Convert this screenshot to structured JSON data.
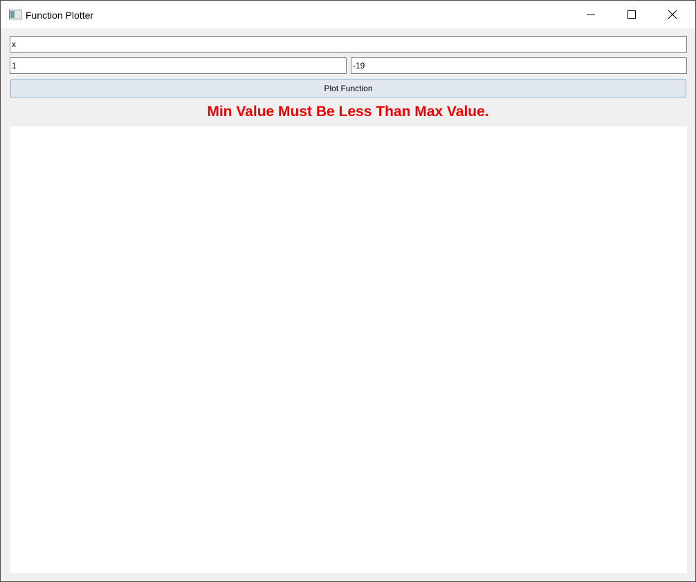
{
  "window": {
    "title": "Function Plotter",
    "icon": "app-window-icon",
    "controls": [
      "minimize-icon",
      "maximize-icon",
      "close-icon"
    ]
  },
  "inputs": {
    "function_value": "x",
    "min_value": "1",
    "max_value": "-19"
  },
  "plot_button": {
    "label": "Plot Function"
  },
  "status": {
    "message": "Min Value Must Be Less Than Max Value.",
    "color": "#ee0000"
  },
  "colors": {
    "window_bg": "#f0f0f0",
    "titlebar_bg": "#ffffff",
    "button_bg": "#e1e8ef",
    "button_border": "#7eaed8",
    "plot_bg": "#ffffff"
  }
}
